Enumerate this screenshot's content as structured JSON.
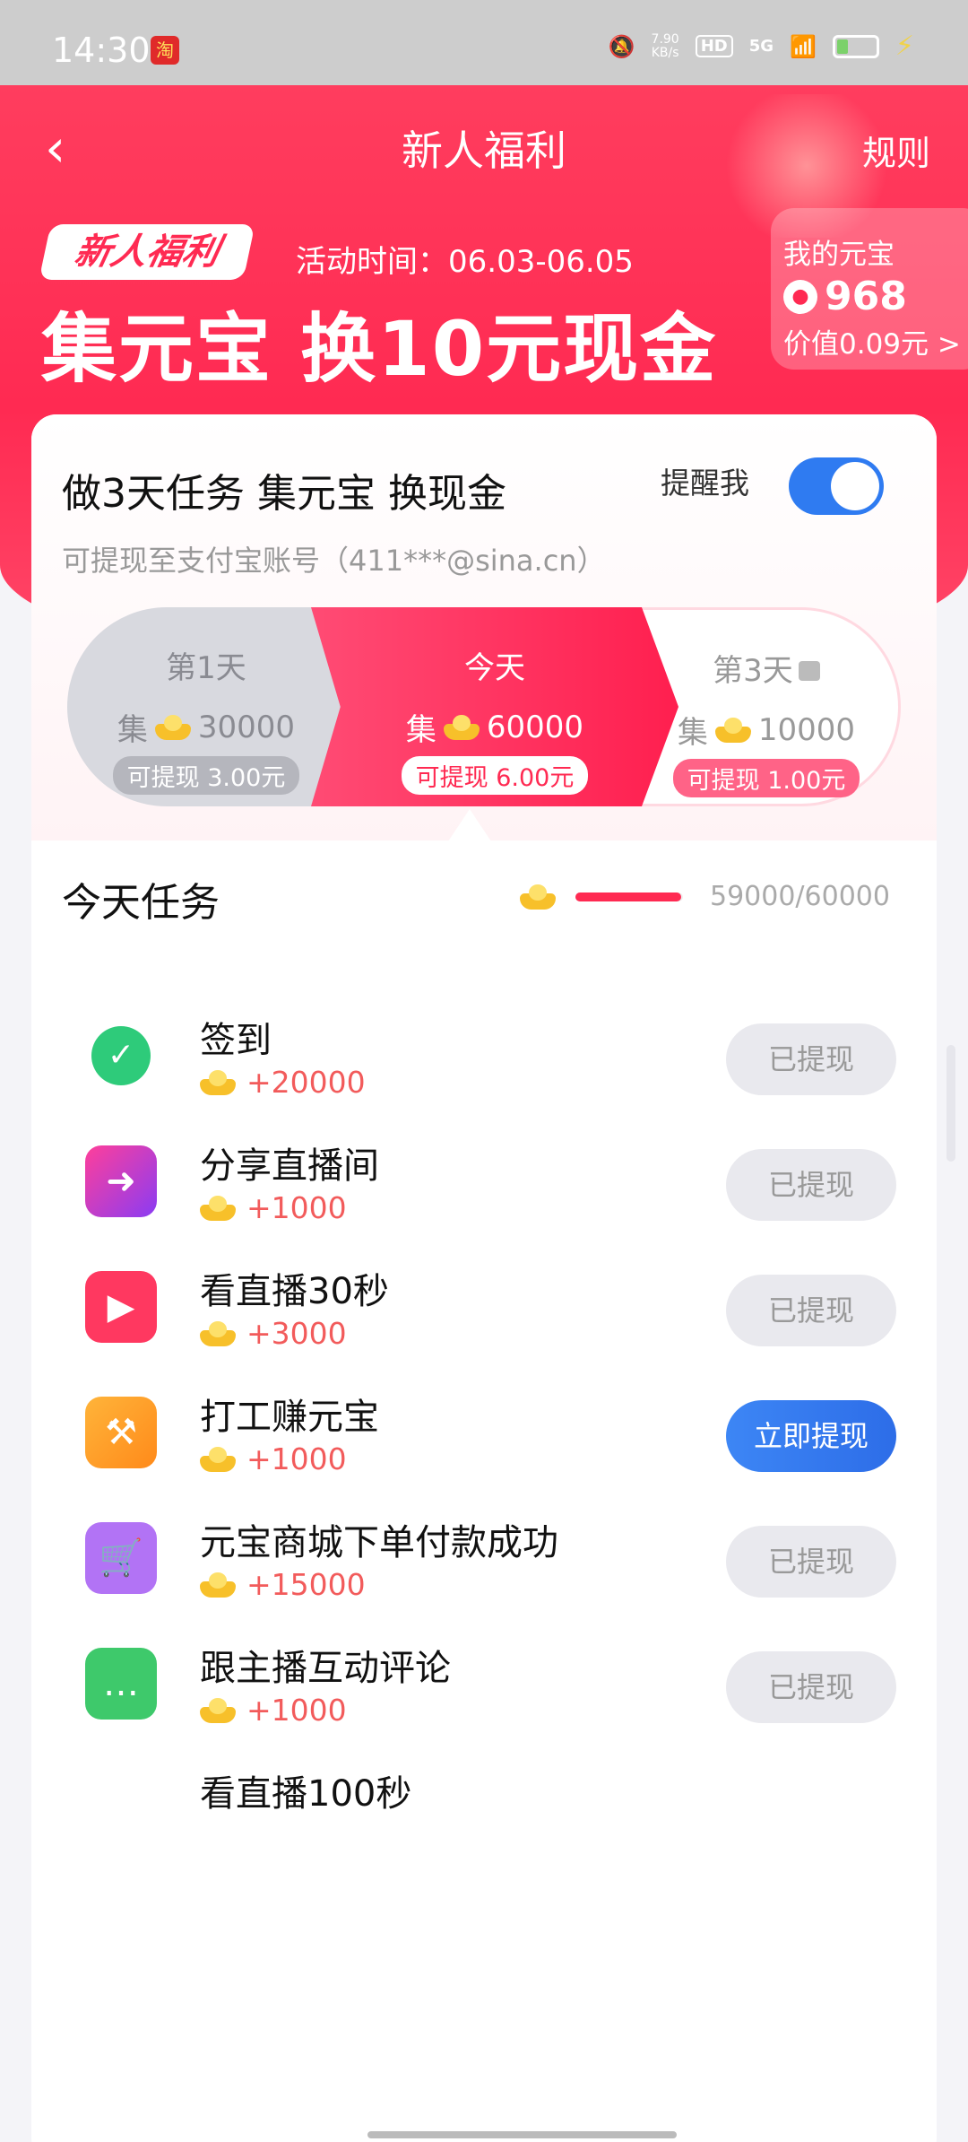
{
  "status_bar": {
    "time": "14:30",
    "net_speed_top": "7.90",
    "net_speed_bottom": "KB/s",
    "hd": "HD",
    "network": "5G"
  },
  "nav": {
    "title": "新人福利",
    "rules": "规则",
    "back_icon": "chevron-left-icon"
  },
  "banner": {
    "badge": "新人福利",
    "activity_time": "活动时间：06.03-06.05",
    "headline": "集元宝 换10元现金"
  },
  "my_coins": {
    "title": "我的元宝",
    "amount": "968",
    "value": "价值0.09元 >"
  },
  "card": {
    "title": "做3天任务 集元宝 换现金",
    "remind_label": "提醒我",
    "remind_on": true,
    "subtitle": "可提现至支付宝账号（411***@sina.cn）"
  },
  "days": [
    {
      "name": "第1天",
      "prefix": "集",
      "coins": "30000",
      "cash": "可提现 3.00元"
    },
    {
      "name": "今天",
      "prefix": "集",
      "coins": "60000",
      "cash": "可提现 6.00元"
    },
    {
      "name": "第3天",
      "prefix": "集",
      "coins": "10000",
      "cash": "可提现 1.00元"
    }
  ],
  "tasks_section": {
    "title": "今天任务",
    "progress_text": "59000/60000",
    "progress_fraction": 0.983
  },
  "tasks": [
    {
      "name": "签到",
      "reward": "+20000",
      "button": "已提现"
    },
    {
      "name": "分享直播间",
      "reward": "+1000",
      "button": "已提现"
    },
    {
      "name": "看直播30秒",
      "reward": "+3000",
      "button": "已提现"
    },
    {
      "name": "打工赚元宝",
      "reward": "+1000",
      "button": "立即提现"
    },
    {
      "name": "元宝商城下单付款成功",
      "reward": "+15000",
      "button": "已提现"
    },
    {
      "name": "跟主播互动评论",
      "reward": "+1000",
      "button": "已提现"
    },
    {
      "name": "看直播100秒",
      "reward": "",
      "button": ""
    }
  ],
  "colors": {
    "brand_red": "#ff2a52",
    "toggle_blue": "#2f7bf1",
    "reward_red": "#f25b5b"
  }
}
